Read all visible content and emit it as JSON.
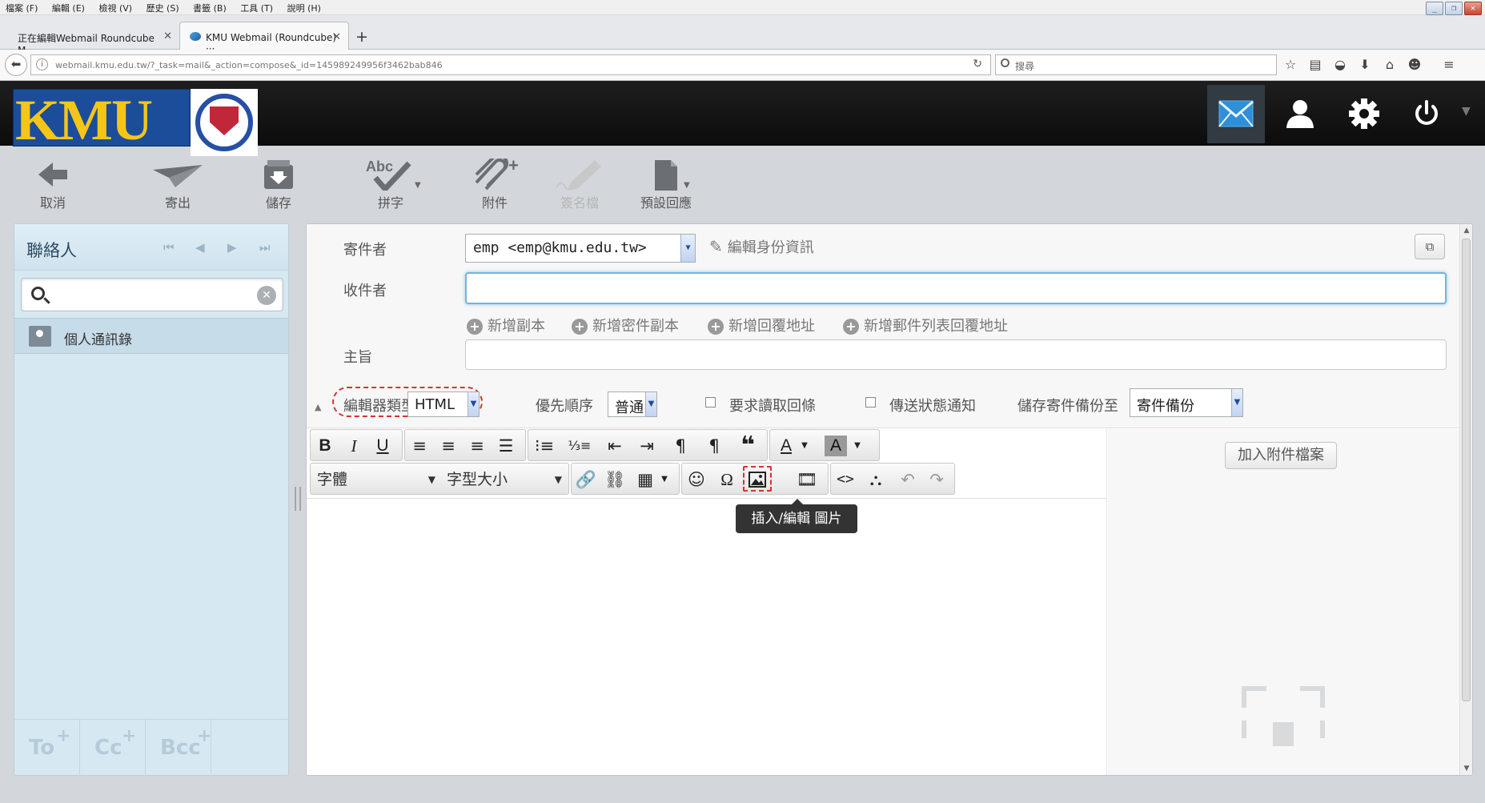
{
  "browser": {
    "menu": [
      "檔案 (F)",
      "編輯 (E)",
      "檢視 (V)",
      "歷史 (S)",
      "書籤 (B)",
      "工具 (T)",
      "說明 (H)"
    ],
    "tabs": [
      {
        "title": "正在編輯Webmail Roundcube M···"
      },
      {
        "title": "KMU Webmail (Roundcube) ···"
      }
    ],
    "new_tab": "+",
    "url": "webmail.kmu.edu.tw/?_task=mail&_action=compose&_id=145989249956f3462bab846",
    "search_placeholder": "搜尋"
  },
  "app": {
    "logo_text": "KMU",
    "toolbar": [
      {
        "label": "取消",
        "icon": "back-arrow-icon"
      },
      {
        "label": "寄出",
        "icon": "send-icon"
      },
      {
        "label": "儲存",
        "icon": "save-icon"
      },
      {
        "label": "拼字",
        "icon": "spellcheck-icon"
      },
      {
        "label": "附件",
        "icon": "paperclip-icon"
      },
      {
        "label": "簽名檔",
        "icon": "signature-icon",
        "disabled": true
      },
      {
        "label": "預設回應",
        "icon": "responses-icon"
      }
    ]
  },
  "contacts": {
    "title": "聯絡人",
    "addressbook": "個人通訊錄",
    "recipient_buttons": [
      "To",
      "Cc",
      "Bcc"
    ]
  },
  "compose": {
    "from_label": "寄件者",
    "from_value": "emp <emp@kmu.edu.tw>",
    "edit_identity": "編輯身份資訊",
    "to_label": "收件者",
    "to_value": "",
    "add_links": [
      "新增副本",
      "新增密件副本",
      "新增回覆地址",
      "新增郵件列表回覆地址"
    ],
    "subject_label": "主旨",
    "subject_value": "",
    "editor_type_label": "編輯器類型",
    "editor_type_value": "HTML",
    "priority_label": "優先順序",
    "priority_value": "普通",
    "mdn_label": "要求讀取回條",
    "dsn_label": "傳送狀態通知",
    "savecopy_label": "儲存寄件備份至",
    "savecopy_value": "寄件備份",
    "font_family_select": "字體",
    "font_size_select": "字型大小",
    "tooltip": "插入/編輯 圖片",
    "attach_button": "加入附件檔案"
  },
  "colors": {
    "accent_highlight": "#d9322e",
    "header_bg": "#111111",
    "contacts_bg": "#d6e8f2",
    "logo_yellow": "#f5c518",
    "logo_blue": "#1c4d9a"
  }
}
